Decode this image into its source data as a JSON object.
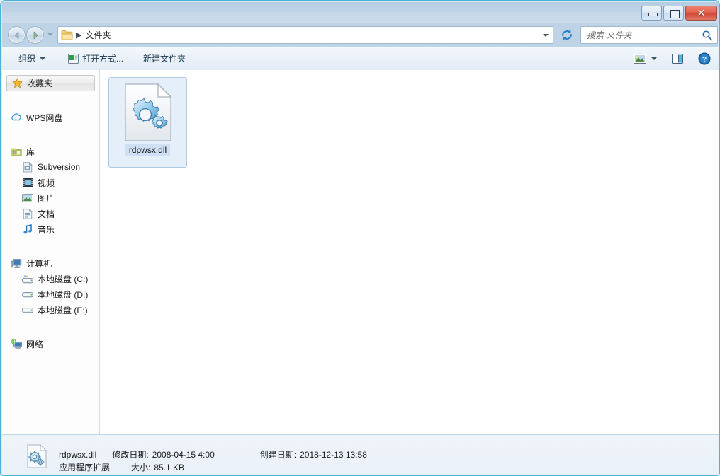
{
  "window": {
    "controls": {
      "minimize_label": "–",
      "maximize_label": "□",
      "close_label": "✕"
    }
  },
  "address_bar": {
    "back_tooltip": "后退",
    "forward_tooltip": "前进",
    "crumb_separator": "▶",
    "path": "文件夹",
    "refresh_label": "↺"
  },
  "search": {
    "placeholder": "搜索 文件夹",
    "value": ""
  },
  "toolbar": {
    "organize_label": "组织",
    "open_with_label": "打开方式...",
    "new_folder_label": "新建文件夹",
    "view_icon": "view-mode-icon",
    "preview_pane_icon": "preview-pane-icon",
    "help_icon": "help-icon"
  },
  "sidebar": {
    "items": [
      {
        "label": "收藏夹",
        "icon": "star-icon",
        "level": 0,
        "selected": true
      },
      {
        "label": "WPS网盘",
        "icon": "cloud-icon",
        "level": 0,
        "selected": false
      },
      {
        "label": "库",
        "icon": "library-icon",
        "level": 0,
        "selected": false
      },
      {
        "label": "Subversion",
        "icon": "subversion-icon",
        "level": 1,
        "selected": false
      },
      {
        "label": "视频",
        "icon": "video-icon",
        "level": 1,
        "selected": false
      },
      {
        "label": "图片",
        "icon": "picture-icon",
        "level": 1,
        "selected": false
      },
      {
        "label": "文档",
        "icon": "document-icon",
        "level": 1,
        "selected": false
      },
      {
        "label": "音乐",
        "icon": "music-icon",
        "level": 1,
        "selected": false
      },
      {
        "label": "计算机",
        "icon": "computer-icon",
        "level": 0,
        "selected": false
      },
      {
        "label": "本地磁盘 (C:)",
        "icon": "system-drive-icon",
        "level": 1,
        "selected": false
      },
      {
        "label": "本地磁盘 (D:)",
        "icon": "drive-icon",
        "level": 1,
        "selected": false
      },
      {
        "label": "本地磁盘 (E:)",
        "icon": "drive-icon",
        "level": 1,
        "selected": false
      },
      {
        "label": "网络",
        "icon": "network-icon",
        "level": 0,
        "selected": false
      }
    ]
  },
  "files": [
    {
      "name": "rdpwsx.dll",
      "icon": "dll-gear-icon",
      "selected": true
    }
  ],
  "status": {
    "file_name": "rdpwsx.dll",
    "modified_label": "修改日期:",
    "modified_value": "2008-04-15 4:00",
    "created_label": "创建日期:",
    "created_value": "2018-12-13 13:58",
    "file_type": "应用程序扩展",
    "size_label": "大小:",
    "size_value": "85.1 KB",
    "icon": "dll-gear-icon"
  },
  "colors": {
    "frame_border": "#4ab4d6",
    "titlebar_top": "#b6cce1",
    "selection": "#cfe0f4",
    "close_button": "#cf4631"
  }
}
